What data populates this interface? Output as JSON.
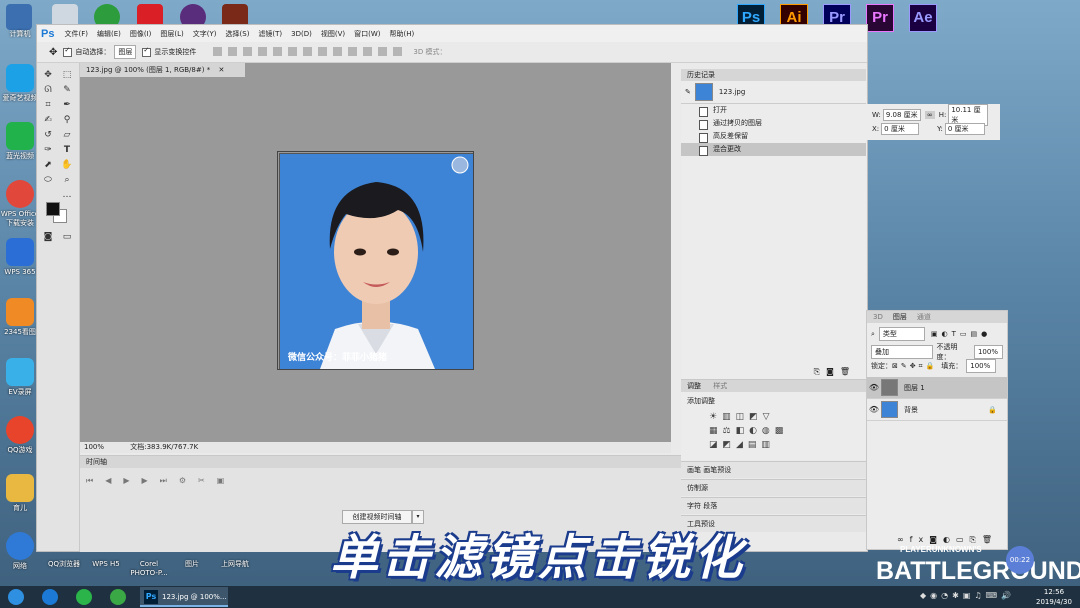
{
  "desktop": {
    "icons": [
      {
        "label": "计算机"
      },
      {
        "label": "爱奇艺视频"
      },
      {
        "label": "蓝光视频"
      },
      {
        "label": "WPS Office下载安装"
      },
      {
        "label": "WPS 365"
      },
      {
        "label": "2345看图"
      },
      {
        "label": "EV录屏"
      },
      {
        "label": "QQ游戏"
      },
      {
        "label": "育儿"
      },
      {
        "label": "网络"
      }
    ],
    "bottom_icons": [
      {
        "label": "QQ浏览器"
      },
      {
        "label": "WPS H5"
      },
      {
        "label": "Corel PHOTO-P..."
      },
      {
        "label": "图片"
      },
      {
        "label": "上网导航"
      }
    ],
    "adobe_apps": [
      {
        "name": "Ps",
        "color": "#31a8ff",
        "bg": "#001e36"
      },
      {
        "name": "Ai",
        "color": "#ff9a00",
        "bg": "#330000"
      },
      {
        "name": "Pr",
        "color": "#9999ff",
        "bg": "#00005b"
      },
      {
        "name": "Pr",
        "color": "#ea77ff",
        "bg": "#2a0634"
      },
      {
        "name": "Ae",
        "color": "#9999ff",
        "bg": "#1a0040"
      }
    ]
  },
  "photoshop": {
    "logo": "Ps",
    "menus": [
      "文件(F)",
      "编辑(E)",
      "图像(I)",
      "图层(L)",
      "文字(Y)",
      "选择(S)",
      "滤镜(T)",
      "3D(D)",
      "视图(V)",
      "窗口(W)",
      "帮助(H)"
    ],
    "options": {
      "auto_select_label": "自动选择：",
      "auto_select_value": "图层",
      "show_transform_label": "显示变换控件",
      "mode_3d_label": "3D 模式："
    },
    "doc_tab": "123.jpg @ 100% (图层 1, RGB/8#) *",
    "canvas_watermark": "微信公众号：菲菲小猪猪",
    "status": {
      "zoom": "100%",
      "doc_info": "文档:383.9K/767.7K"
    },
    "timeline": {
      "title": "时间轴",
      "create_button": "创建视频时间轴"
    },
    "history": {
      "title": "历史记录",
      "snapshot": "123.jpg",
      "items": [
        {
          "label": "打开",
          "selected": false
        },
        {
          "label": "通过拷贝的图层",
          "selected": false
        },
        {
          "label": "高反差保留",
          "selected": false
        },
        {
          "label": "混合更改",
          "selected": true
        }
      ]
    },
    "adjustments": {
      "tab1": "调整",
      "tab2": "样式",
      "add_label": "添加调整"
    },
    "collapsed_panels": [
      {
        "label": "画笔  画笔预设"
      },
      {
        "label": "仿制源"
      },
      {
        "label": "字符  段落"
      },
      {
        "label": "工具预设"
      }
    ],
    "properties": {
      "w_label": "W:",
      "w_value": "9.08 厘米",
      "h_label": "H:",
      "h_value": "10.11 厘米",
      "x_label": "X:",
      "x_value": "0 厘米",
      "y_label": "Y:",
      "y_value": "0 厘米"
    },
    "layers": {
      "tabs": [
        "3D",
        "图层",
        "通道"
      ],
      "filter": "类型",
      "blend_mode": "叠加",
      "opacity_label": "不透明度：",
      "opacity_value": "100%",
      "lock_label": "锁定：",
      "fill_label": "填充：",
      "fill_value": "100%",
      "rows": [
        {
          "name": "图层 1",
          "selected": true
        },
        {
          "name": "背景",
          "selected": false
        }
      ]
    }
  },
  "overlay": {
    "subtitle": "单击滤镜点击锐化",
    "game_logo": "BATTLEGROUNDS",
    "game_logo_top": "PLAYERUNKNOWN'S",
    "timer": "00:22"
  },
  "taskbar": {
    "task_label": "123.jpg @ 100%...",
    "time": "12:56",
    "date": "2019/4/30"
  }
}
